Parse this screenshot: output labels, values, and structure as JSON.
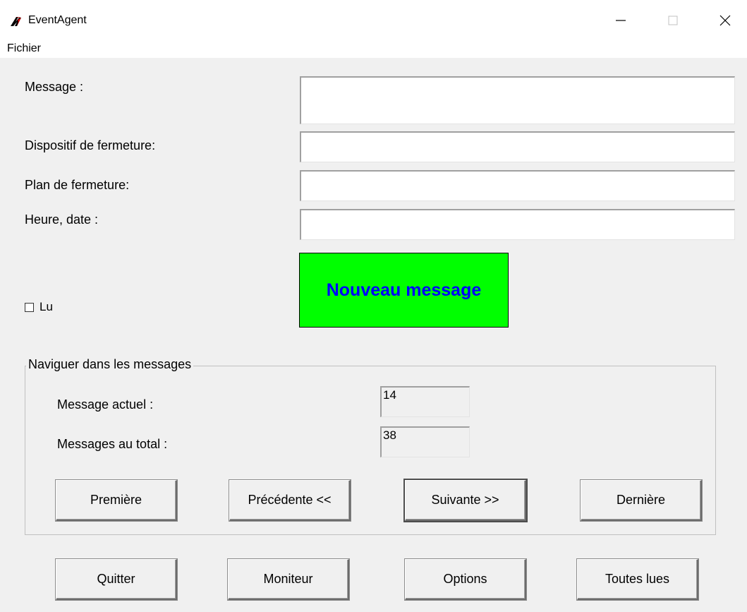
{
  "window": {
    "title": "EventAgent",
    "icon": "eventagent-logo-icon",
    "controls": [
      "minimize-icon",
      "maximize-icon",
      "close-icon"
    ]
  },
  "menu": {
    "items": [
      "Fichier"
    ]
  },
  "form": {
    "message_label": "Message :",
    "message_value": "",
    "device_label": "Dispositif de fermeture:",
    "device_value": "",
    "plan_label": "Plan de fermeture:",
    "plan_value": "",
    "datetime_label": "Heure, date :",
    "datetime_value": ""
  },
  "read_checkbox": {
    "label": "Lu",
    "checked": false
  },
  "status": {
    "text": "Nouveau message",
    "background": "#00ff00",
    "color": "#0000ff"
  },
  "navigation": {
    "legend": "Naviguer dans les messages",
    "current_label": "Message actuel :",
    "current_value": "14",
    "total_label": "Messages au total :",
    "total_value": "38",
    "buttons": {
      "first": "Première",
      "previous": "Précédente <<",
      "next": "Suivante >>",
      "last": "Dernière"
    }
  },
  "actions": {
    "quit": "Quitter",
    "monitor": "Moniteur",
    "options": "Options",
    "mark_all_read": "Toutes lues"
  }
}
